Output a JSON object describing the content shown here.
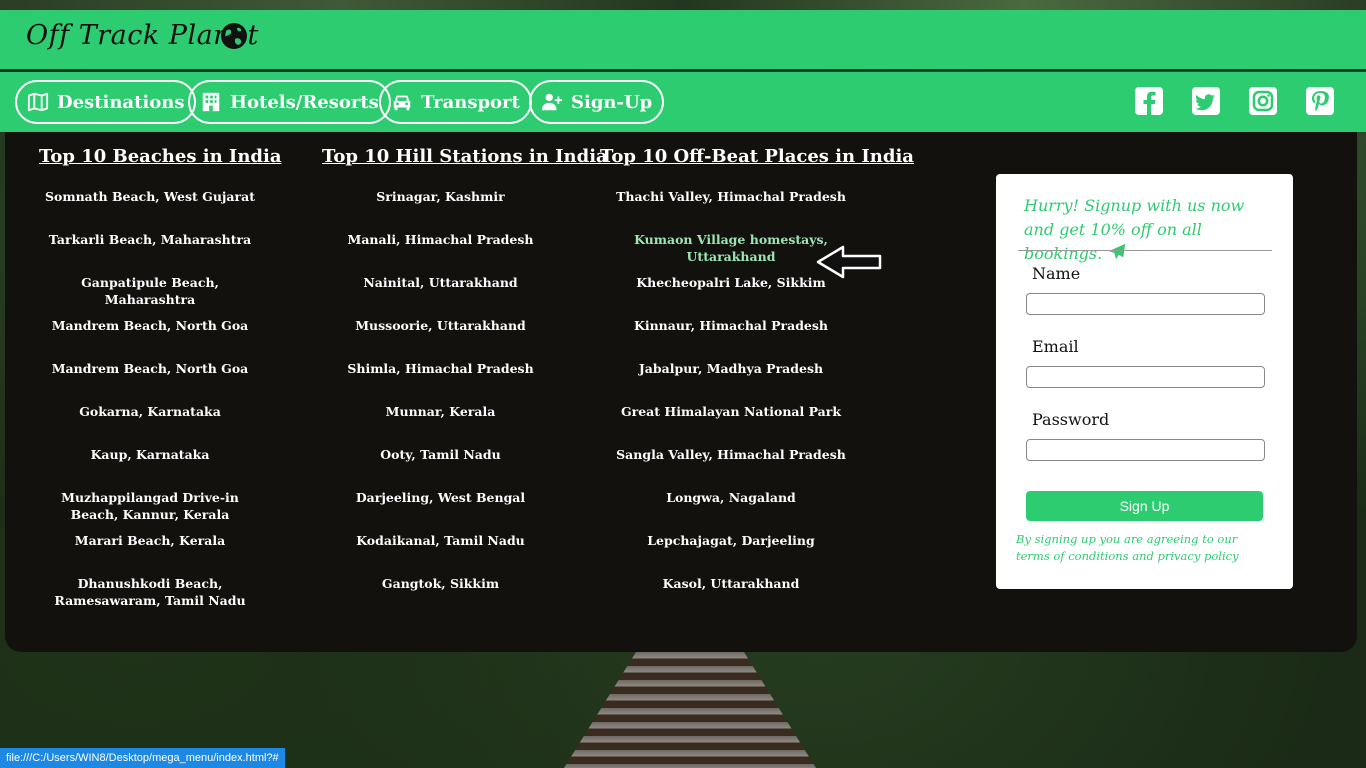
{
  "brand": {
    "name": "Off Track Planet"
  },
  "nav": {
    "items": [
      {
        "label": "Destinations",
        "icon": "map-icon"
      },
      {
        "label": "Hotels/Resorts",
        "icon": "hotel-icon"
      },
      {
        "label": "Transport",
        "icon": "car-icon"
      },
      {
        "label": "Sign-Up",
        "icon": "user-plus-icon"
      }
    ],
    "social": [
      "facebook-icon",
      "twitter-icon",
      "instagram-icon",
      "pinterest-icon"
    ]
  },
  "columns": [
    {
      "title": "Top 10 Beaches in India",
      "items": [
        "Somnath Beach, West Gujarat",
        "Tarkarli Beach, Maharashtra",
        "Ganpatipule Beach, Maharashtra",
        "Mandrem Beach, North Goa",
        "Mandrem Beach, North Goa",
        "Gokarna, Karnataka",
        "Kaup, Karnataka",
        "Muzhappilangad Drive-in Beach, Kannur, Kerala",
        "Marari Beach, Kerala",
        "Dhanushkodi Beach, Ramesawaram, Tamil Nadu"
      ]
    },
    {
      "title": "Top 10 Hill Stations in India",
      "items": [
        "Srinagar, Kashmir",
        "Manali, Himachal Pradesh",
        "Nainital, Uttarakhand",
        "Mussoorie, Uttarakhand",
        "Shimla, Himachal Pradesh",
        "Munnar, Kerala",
        "Ooty, Tamil Nadu",
        "Darjeeling, West Bengal",
        "Kodaikanal, Tamil Nadu",
        "Gangtok, Sikkim"
      ]
    },
    {
      "title": "Top 10 Off-Beat Places in India",
      "items": [
        "Thachi Valley, Himachal Pradesh",
        "Kumaon Village homestays, Uttarakhand",
        "Khecheopalri Lake, Sikkim",
        "Kinnaur, Himachal Pradesh",
        "Jabalpur, Madhya Pradesh",
        "Great Himalayan National Park",
        "Sangla Valley, Himachal Pradesh",
        "Longwa, Nagaland",
        "Lepchajagat, Darjeeling",
        "Kasol, Uttarakhand"
      ],
      "hovered_index": 1
    }
  ],
  "signup": {
    "promo": "Hurry! Signup with us now and get 10% off on all bookings.",
    "name_label": "Name",
    "email_label": "Email",
    "password_label": "Password",
    "button": "Sign Up",
    "terms": "By signing up you are agreeing to our terms of conditions and privacy policy"
  },
  "status_url": "file:///C:/Users/WIN8/Desktop/mega_menu/index.html?#",
  "colors": {
    "accent": "#2ecc71",
    "panel": "#13110e",
    "hover": "#9be7b3"
  }
}
